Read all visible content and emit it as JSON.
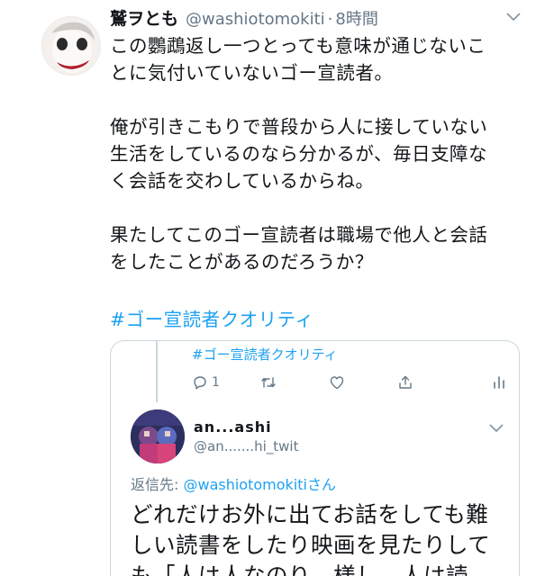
{
  "tweet": {
    "display_name": "鷲ヲとも",
    "handle": "@washiotomokiti",
    "separator": "·",
    "time": "8時間",
    "paragraphs": [
      [
        "この鸚鵡返し一つとっても意味が通じないこ",
        "とに気付いていないゴー宣読者。"
      ],
      [
        "俺が引きこもりで普段から人に接していない",
        "生活をしているのなら分かるが、毎日支障な",
        "く会話を交わしているからね。"
      ],
      [
        "果たしてこのゴー宣読者は職場で他人と会話",
        "をしたことがあるのだろうか？"
      ]
    ],
    "hashtag": "#ゴー宣読者クオリティ"
  },
  "quoted": {
    "hashtag": "#ゴー宣読者クオリティ",
    "reply_count": "1",
    "name": "an...ashi",
    "handle": "@an.......hi_twit",
    "reply_prefix": "返信先: ",
    "reply_mention": "@washiotomokitiさん",
    "text_lines": [
      "どれだけお外に出てお話をしても難",
      "しい読書をしたり映画を見たりして",
      "も「人は人なのり　様し　人は読"
    ]
  },
  "colors": {
    "accent": "#1da1f2",
    "muted": "#657786",
    "text": "#14171a",
    "border": "#ccd6dd"
  },
  "icons": [
    "chevron-down-icon",
    "reply-icon",
    "retweet-icon",
    "like-icon",
    "share-icon",
    "analytics-icon"
  ]
}
